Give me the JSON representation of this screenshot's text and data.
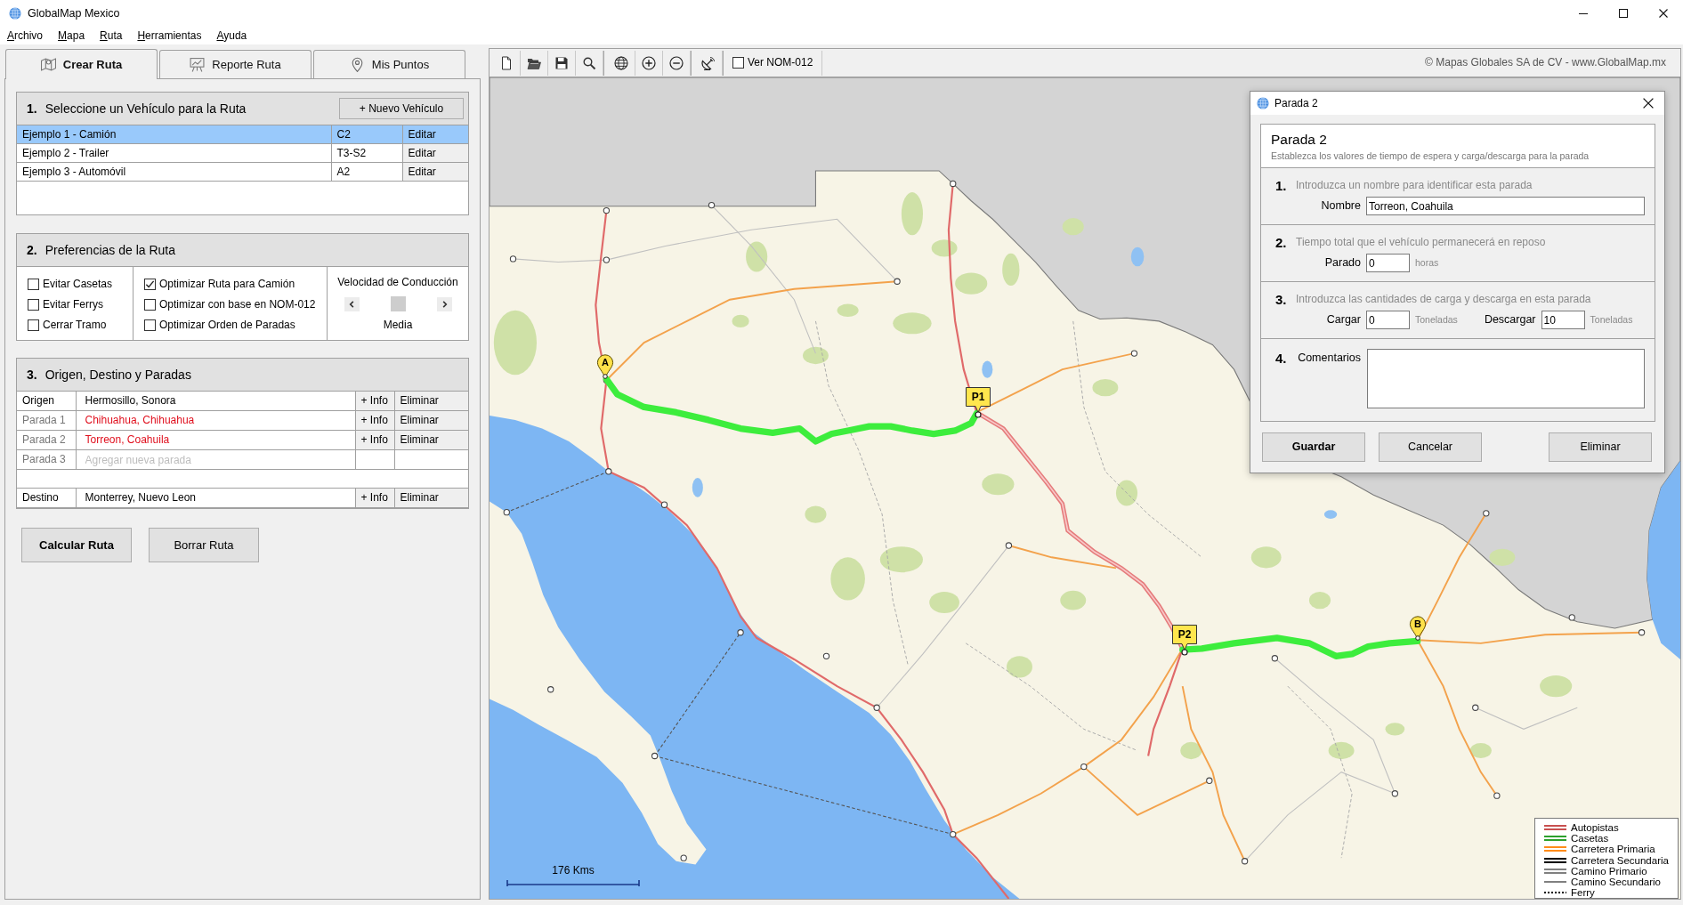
{
  "window": {
    "title": "GlobalMap Mexico"
  },
  "menu": [
    "Archivo",
    "Mapa",
    "Ruta",
    "Herramientas",
    "Ayuda"
  ],
  "tabs": [
    {
      "label": "Crear Ruta",
      "selected": true
    },
    {
      "label": "Reporte Ruta",
      "selected": false
    },
    {
      "label": "Mis Puntos",
      "selected": false
    }
  ],
  "vehicle_section": {
    "number": "1.",
    "title": "Seleccione un Vehículo para la Ruta",
    "new_button": "+ Nuevo Vehículo",
    "rows": [
      {
        "name": "Ejemplo 1 - Camión",
        "type": "C2",
        "action": "Editar",
        "selected": true
      },
      {
        "name": "Ejemplo 2 - Trailer",
        "type": "T3-S2",
        "action": "Editar",
        "selected": false
      },
      {
        "name": "Ejemplo 3 - Automóvil",
        "type": "A2",
        "action": "Editar",
        "selected": false
      }
    ]
  },
  "preferences_section": {
    "number": "2.",
    "title": "Preferencias de la Ruta",
    "option_columns": [
      [
        {
          "label": "Evitar Casetas",
          "checked": false
        },
        {
          "label": "Evitar Ferrys",
          "checked": false
        },
        {
          "label": "Cerrar Tramo",
          "checked": false
        }
      ],
      [
        {
          "label": "Optimizar Ruta para Camión",
          "checked": true
        },
        {
          "label": "Optimizar con base en NOM-012",
          "checked": false
        },
        {
          "label": "Optimizar Orden de Paradas",
          "checked": false
        }
      ]
    ],
    "speed": {
      "title": "Velocidad de Conducción",
      "level": 0.5,
      "value": "Media"
    }
  },
  "stops_section": {
    "number": "3.",
    "title": "Origen, Destino y Paradas",
    "rows": [
      {
        "kind": "origin",
        "label": "Origen",
        "value": "Hermosillo, Sonora",
        "info": "+ Info",
        "delete": "Eliminar"
      },
      {
        "kind": "waypoint",
        "label": "Parada 1",
        "value": "Chihuahua, Chihuahua",
        "info": "+ Info",
        "delete": "Eliminar"
      },
      {
        "kind": "waypoint",
        "label": "Parada 2",
        "value": "Torreon, Coahuila",
        "info": "+ Info",
        "delete": "Eliminar"
      },
      {
        "kind": "new",
        "label": "Parada 3",
        "placeholder": "Agregar nueva parada"
      }
    ],
    "destination": {
      "kind": "destination",
      "label": "Destino",
      "value": "Monterrey, Nuevo Leon",
      "info": "+ Info",
      "delete": "Eliminar"
    }
  },
  "actions": [
    {
      "label": "Calcular Ruta",
      "default": true
    },
    {
      "label": "Borrar Ruta",
      "default": false
    }
  ],
  "map_toolbar": {
    "nom_toggle": {
      "label": "Ver NOM-012",
      "checked": false
    },
    "copyright": "© Mapas Globales SA de CV - www.GlobalMap.mx"
  },
  "map": {
    "markers": [
      {
        "kind": "pin",
        "label": "A"
      },
      {
        "kind": "flag",
        "label": "P1"
      },
      {
        "kind": "flag",
        "label": "P2"
      },
      {
        "kind": "pin",
        "label": "B"
      }
    ],
    "scale": "176 Kms",
    "legend": [
      {
        "kind": "double",
        "label": "Autopistas",
        "color": "#c85050"
      },
      {
        "kind": "double",
        "label": "Casetas",
        "color": "#2ca02c"
      },
      {
        "kind": "double",
        "label": "Carretera Primaria",
        "color": "#ff8c1a"
      },
      {
        "kind": "double",
        "label": "Carretera Secundaria",
        "color": "#000000"
      },
      {
        "kind": "double",
        "label": "Camino Primario",
        "color": "#808080"
      },
      {
        "kind": "single",
        "label": "Camino Secundario",
        "color": "#808080"
      },
      {
        "kind": "dotted",
        "label": "Ferry",
        "color": "#000000"
      }
    ]
  },
  "dialog": {
    "title": "Parada 2",
    "heading": "Parada 2",
    "subtitle": "Establezca los valores de tiempo de espera y carga/descarga para la parada",
    "steps": [
      {
        "kind": "fields",
        "number": "1.",
        "prompt": "Introduzca un nombre para identificar esta parada",
        "fields": [
          {
            "kind": "text",
            "label": "Nombre",
            "value": "Torreon, Coahuila"
          }
        ]
      },
      {
        "kind": "fields",
        "number": "2.",
        "prompt": "Tiempo total que el vehículo permanecerá en reposo",
        "fields": [
          {
            "kind": "number",
            "label": "Parado",
            "value": "0",
            "unit": "horas"
          }
        ]
      },
      {
        "kind": "fields",
        "number": "3.",
        "prompt": "Introduzca las cantidades de carga y descarga en esta parada",
        "fields": [
          {
            "kind": "number",
            "label": "Cargar",
            "value": "0",
            "unit": "Toneladas"
          },
          {
            "kind": "number",
            "label": "Descargar",
            "value": "10",
            "unit": "Toneladas"
          }
        ]
      },
      {
        "kind": "comments",
        "number": "4.",
        "label": "Comentarios"
      }
    ],
    "buttons": [
      {
        "label": "Guardar",
        "default": true
      },
      {
        "label": "Cancelar",
        "default": false
      },
      {
        "label": "Eliminar",
        "default": false
      }
    ]
  }
}
